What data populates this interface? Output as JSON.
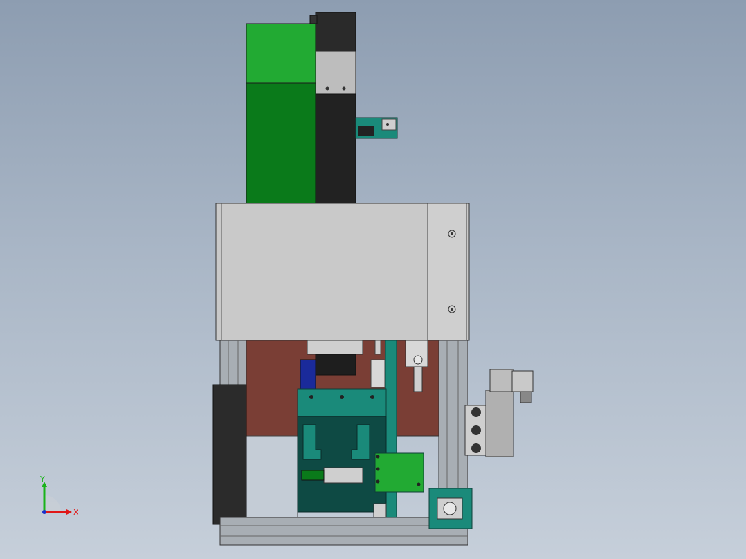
{
  "window": {
    "title": ""
  },
  "triad": {
    "x_label": "X",
    "y_label": "Y",
    "x_color": "#e01818",
    "y_color": "#19b319",
    "z_color": "#1a2fcc"
  },
  "colors": {
    "background_top": "#8d9db1",
    "background_bottom": "#c6cfda",
    "housing_green": "#0a7a1a",
    "housing_green_light": "#22aa33",
    "cover_gray": "#c8c8c8",
    "base_plate_red": "#7a3e35",
    "teal_part": "#1a8a7a",
    "dark_teal": "#0e4a44",
    "motor_black": "#222222",
    "frame_gray": "#a8aeb4"
  },
  "icons": {
    "coordinate_triad": "xyz-axes-icon"
  }
}
